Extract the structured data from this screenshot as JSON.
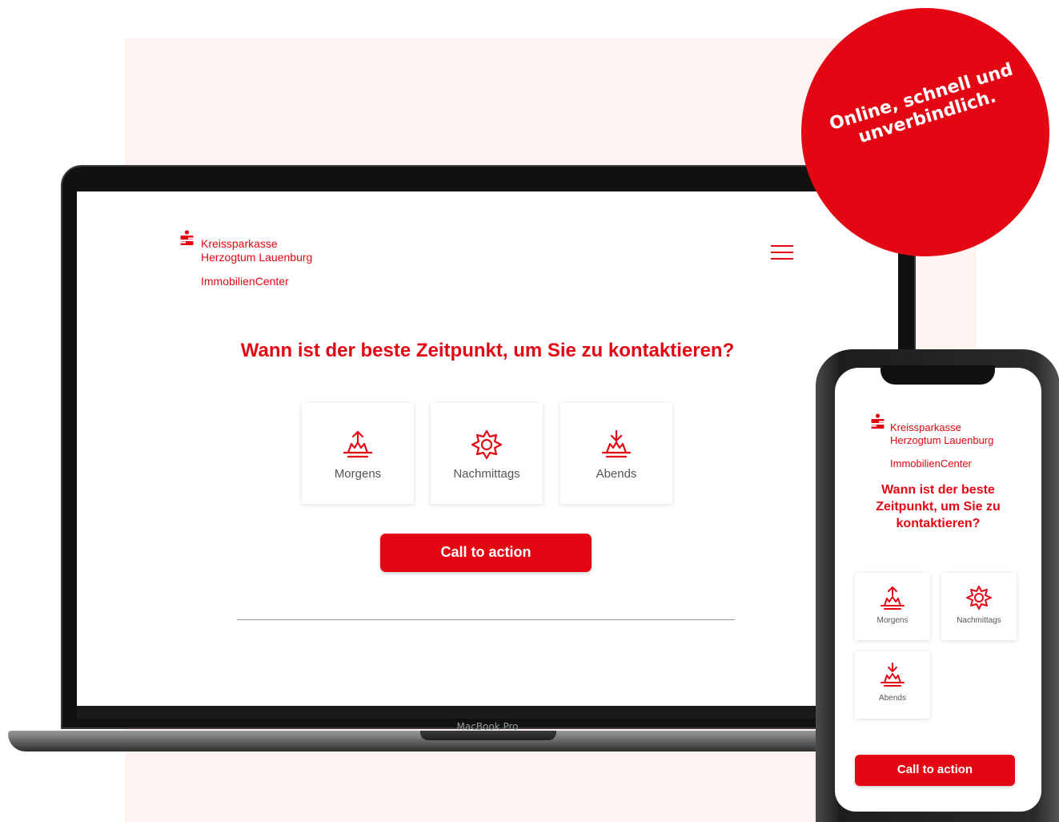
{
  "badge": {
    "line1": "Online, schnell und",
    "line2": "unverbindlich."
  },
  "device_label": "MacBook Pro",
  "brand": {
    "logo_symbol": "Ṡ",
    "name_line1": "Kreissparkasse",
    "name_line2": "Herzogtum Lauenburg",
    "subtitle": "ImmobilienCenter"
  },
  "question": "Wann ist der beste Zeitpunkt, um Sie zu kontaktieren?",
  "options": [
    {
      "label": "Morgens",
      "icon": "sunrise-icon"
    },
    {
      "label": "Nachmittags",
      "icon": "sun-icon"
    },
    {
      "label": "Abends",
      "icon": "sunset-icon"
    }
  ],
  "cta_label": "Call to action",
  "colors": {
    "brand_red": "#e30613",
    "background_tint": "#fdf3f1"
  }
}
